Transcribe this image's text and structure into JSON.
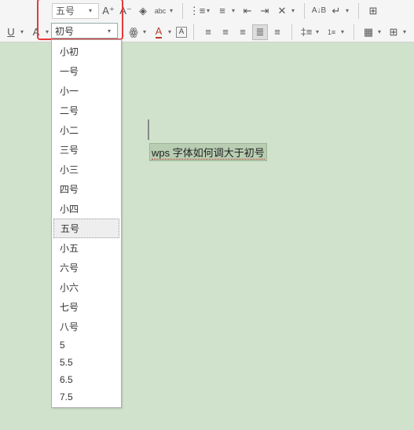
{
  "toolbar": {
    "font_size_display": "五号",
    "font_size_active": "初号",
    "icons_row1": [
      "A⁺",
      "A⁻",
      "◇",
      "abc",
      "",
      "≔",
      "≔",
      "⇐",
      "⇒",
      "✕",
      "",
      "AB",
      "↩",
      "",
      "⊞"
    ],
    "icons_row2": [
      "U",
      "A",
      "",
      "啊",
      "▭",
      "A",
      "A",
      "▢",
      "",
      "≡",
      "≡",
      "≡",
      "≣",
      "≡",
      "",
      "‡≡",
      "1≡",
      "",
      "⊡",
      "⊞",
      ""
    ]
  },
  "dropdown": {
    "items": [
      "小初",
      "一号",
      "小一",
      "二号",
      "小二",
      "三号",
      "小三",
      "四号",
      "小四",
      "五号",
      "小五",
      "六号",
      "小六",
      "七号",
      "八号",
      "5",
      "5.5",
      "6.5",
      "7.5"
    ],
    "selected_index": 9
  },
  "document": {
    "selected_text": "wps 字体如何调大于初号"
  }
}
